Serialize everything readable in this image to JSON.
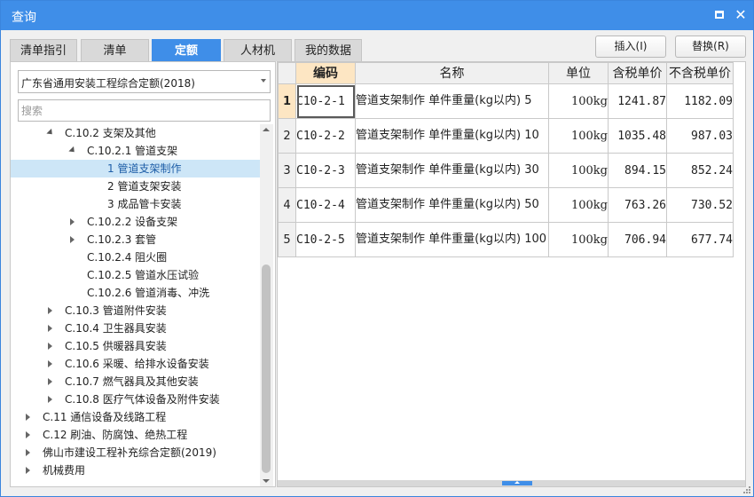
{
  "window": {
    "title": "查询"
  },
  "tabs": [
    {
      "label": "清单指引",
      "active": false
    },
    {
      "label": "清单",
      "active": false
    },
    {
      "label": "定额",
      "active": true
    },
    {
      "label": "人材机",
      "active": false
    },
    {
      "label": "我的数据",
      "active": false
    }
  ],
  "actions": {
    "insert_label": "插入(I)",
    "replace_label": "替换(R)"
  },
  "left": {
    "library_selected": "广东省通用安装工程综合定额(2018)",
    "search_placeholder": "搜索",
    "tree": [
      {
        "label": "C.10.2 支架及其他",
        "level": 2,
        "toggle": "expanded"
      },
      {
        "label": "C.10.2.1 管道支架",
        "level": 3,
        "toggle": "expanded"
      },
      {
        "label": "1 管道支架制作",
        "level": 4,
        "toggle": "none",
        "selected": true
      },
      {
        "label": "2 管道支架安装",
        "level": 4,
        "toggle": "none"
      },
      {
        "label": "3 成品管卡安装",
        "level": 4,
        "toggle": "none"
      },
      {
        "label": "C.10.2.2 设备支架",
        "level": 3,
        "toggle": "collapsed"
      },
      {
        "label": "C.10.2.3 套管",
        "level": 3,
        "toggle": "collapsed"
      },
      {
        "label": "C.10.2.4 阻火圈",
        "level": 3,
        "toggle": "none"
      },
      {
        "label": "C.10.2.5 管道水压试验",
        "level": 3,
        "toggle": "none"
      },
      {
        "label": "C.10.2.6 管道消毒、冲洗",
        "level": 3,
        "toggle": "none"
      },
      {
        "label": "C.10.3 管道附件安装",
        "level": 2,
        "toggle": "collapsed"
      },
      {
        "label": "C.10.4 卫生器具安装",
        "level": 2,
        "toggle": "collapsed"
      },
      {
        "label": "C.10.5 供暖器具安装",
        "level": 2,
        "toggle": "collapsed"
      },
      {
        "label": "C.10.6 采暖、给排水设备安装",
        "level": 2,
        "toggle": "collapsed"
      },
      {
        "label": "C.10.7 燃气器具及其他安装",
        "level": 2,
        "toggle": "collapsed"
      },
      {
        "label": "C.10.8 医疗气体设备及附件安装",
        "level": 2,
        "toggle": "collapsed"
      },
      {
        "label": "C.11 通信设备及线路工程",
        "level": 1,
        "toggle": "collapsed"
      },
      {
        "label": "C.12 刷油、防腐蚀、绝热工程",
        "level": 1,
        "toggle": "collapsed"
      },
      {
        "label": "佛山市建设工程补充综合定额(2019)",
        "level": 1,
        "toggle": "collapsed"
      },
      {
        "label": "机械费用",
        "level": 1,
        "toggle": "collapsed"
      }
    ]
  },
  "table": {
    "headers": {
      "code": "编码",
      "name": "名称",
      "unit": "单位",
      "tax_price": "含税单价",
      "notax_price": "不含税单价"
    },
    "rows": [
      {
        "no": "1",
        "code": "C10-2-1",
        "name": "管道支架制作 单件重量(kg以内) 5",
        "unit": "100kg",
        "tax_price": "1241.87",
        "notax_price": "1182.09"
      },
      {
        "no": "2",
        "code": "C10-2-2",
        "name": "管道支架制作 单件重量(kg以内) 10",
        "unit": "100kg",
        "tax_price": "1035.48",
        "notax_price": "987.03"
      },
      {
        "no": "3",
        "code": "C10-2-3",
        "name": "管道支架制作 单件重量(kg以内) 30",
        "unit": "100kg",
        "tax_price": "894.15",
        "notax_price": "852.24"
      },
      {
        "no": "4",
        "code": "C10-2-4",
        "name": "管道支架制作 单件重量(kg以内) 50",
        "unit": "100kg",
        "tax_price": "763.26",
        "notax_price": "730.52"
      },
      {
        "no": "5",
        "code": "C10-2-5",
        "name": "管道支架制作 单件重量(kg以内) 100",
        "unit": "100kg",
        "tax_price": "706.94",
        "notax_price": "677.74"
      }
    ]
  },
  "colors": {
    "accent": "#3f8ee8",
    "selected_row": "#cde6f7",
    "sorted_header": "#fde6c3"
  }
}
